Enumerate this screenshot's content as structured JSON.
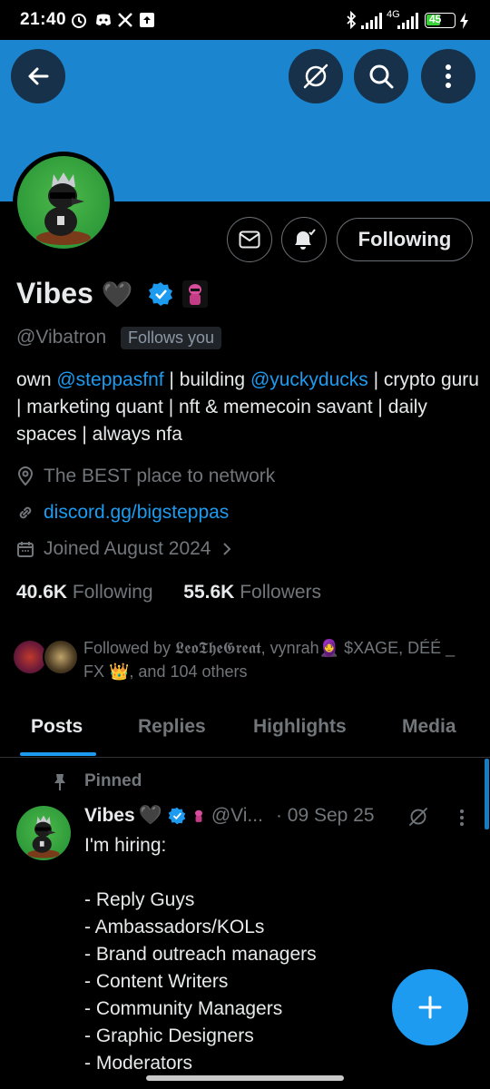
{
  "status_bar": {
    "time": "21:40",
    "network_label": "4G",
    "battery": "45"
  },
  "profile": {
    "name": "Vibes",
    "name_emoji": "🖤",
    "handle": "@Vibatron",
    "follows_you": "Follows you",
    "bio": {
      "p1": "own ",
      "m1": "@steppasfnf",
      "p2": " | building ",
      "m2": "@yuckyducks",
      "p3": " | crypto guru | marketing quant | nft & memecoin savant | daily spaces | always nfa"
    },
    "location": "The BEST place to network",
    "website": "discord.gg/bigsteppas",
    "joined": "Joined August 2024",
    "following_count": "40.6K",
    "following_label": "Following",
    "followers_count": "55.6K",
    "followers_label": "Followers",
    "followed_by": "Followed by 𝕷𝖊𝖔𝕿𝖍𝖊𝕲𝖗𝖊𝖆𝖙, vynrah🧕 $XAGE, DÉÉ _ FX 👑, and 104 others"
  },
  "actions": {
    "following_button": "Following"
  },
  "tabs": [
    {
      "label": "Posts"
    },
    {
      "label": "Replies"
    },
    {
      "label": "Highlights"
    },
    {
      "label": "Media"
    }
  ],
  "pinned_post": {
    "pinned_label": "Pinned",
    "author": "Vibes",
    "author_emoji": "🖤",
    "handle": "@Vi...",
    "date": "· 09 Sep 25",
    "text": "I'm hiring:\n\n- Reply Guys\n- Ambassadors/KOLs\n- Brand outreach managers\n- Content Writers\n- Community Managers\n- Graphic Designers\n- Moderators"
  },
  "colors": {
    "banner": "#1b85cf",
    "accent": "#1d9bf0",
    "background": "#000000",
    "muted_text": "#71767b"
  },
  "icons": [
    "back-arrow-icon",
    "grok-icon",
    "search-icon",
    "more-vertical-icon",
    "mail-icon",
    "bell-subscribed-icon",
    "verified-badge-icon",
    "location-icon",
    "link-icon",
    "calendar-icon",
    "chevron-right-icon",
    "pin-icon",
    "compose-plus-icon"
  ]
}
